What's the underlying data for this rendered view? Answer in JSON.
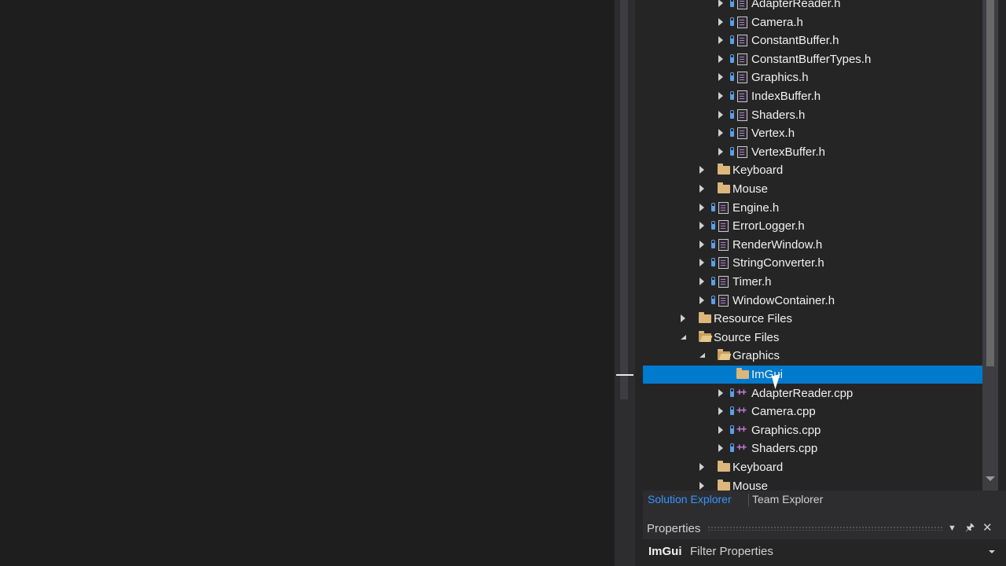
{
  "tree": [
    {
      "label": "AdapterReader.h",
      "indent": 3,
      "type": "file-h",
      "state": "collapsed",
      "lock": true
    },
    {
      "label": "Camera.h",
      "indent": 3,
      "type": "file-h",
      "state": "collapsed",
      "lock": true
    },
    {
      "label": "ConstantBuffer.h",
      "indent": 3,
      "type": "file-h",
      "state": "collapsed",
      "lock": true
    },
    {
      "label": "ConstantBufferTypes.h",
      "indent": 3,
      "type": "file-h",
      "state": "collapsed",
      "lock": true
    },
    {
      "label": "Graphics.h",
      "indent": 3,
      "type": "file-h",
      "state": "collapsed",
      "lock": true
    },
    {
      "label": "IndexBuffer.h",
      "indent": 3,
      "type": "file-h",
      "state": "collapsed",
      "lock": true
    },
    {
      "label": "Shaders.h",
      "indent": 3,
      "type": "file-h",
      "state": "collapsed",
      "lock": true
    },
    {
      "label": "Vertex.h",
      "indent": 3,
      "type": "file-h",
      "state": "collapsed",
      "lock": true
    },
    {
      "label": "VertexBuffer.h",
      "indent": 3,
      "type": "file-h",
      "state": "collapsed",
      "lock": true
    },
    {
      "label": "Keyboard",
      "indent": 2,
      "type": "folder",
      "state": "collapsed",
      "lock": false
    },
    {
      "label": "Mouse",
      "indent": 2,
      "type": "folder",
      "state": "collapsed",
      "lock": false
    },
    {
      "label": "Engine.h",
      "indent": 2,
      "type": "file-h",
      "state": "collapsed",
      "lock": true
    },
    {
      "label": "ErrorLogger.h",
      "indent": 2,
      "type": "file-h",
      "state": "collapsed",
      "lock": true
    },
    {
      "label": "RenderWindow.h",
      "indent": 2,
      "type": "file-h",
      "state": "collapsed",
      "lock": true
    },
    {
      "label": "StringConverter.h",
      "indent": 2,
      "type": "file-h",
      "state": "collapsed",
      "lock": true
    },
    {
      "label": "Timer.h",
      "indent": 2,
      "type": "file-h",
      "state": "collapsed",
      "lock": true
    },
    {
      "label": "WindowContainer.h",
      "indent": 2,
      "type": "file-h",
      "state": "collapsed",
      "lock": true
    },
    {
      "label": "Resource Files",
      "indent": 1,
      "type": "folder",
      "state": "collapsed",
      "lock": false
    },
    {
      "label": "Source Files",
      "indent": 1,
      "type": "folder-open",
      "state": "expanded",
      "lock": false
    },
    {
      "label": "Graphics",
      "indent": 2,
      "type": "folder-open",
      "state": "expanded",
      "lock": false
    },
    {
      "label": "ImGui",
      "indent": 3,
      "type": "folder",
      "state": "none",
      "lock": false,
      "selected": true
    },
    {
      "label": "AdapterReader.cpp",
      "indent": 3,
      "type": "file-cpp",
      "state": "collapsed",
      "lock": true
    },
    {
      "label": "Camera.cpp",
      "indent": 3,
      "type": "file-cpp",
      "state": "collapsed",
      "lock": true
    },
    {
      "label": "Graphics.cpp",
      "indent": 3,
      "type": "file-cpp",
      "state": "collapsed",
      "lock": true
    },
    {
      "label": "Shaders.cpp",
      "indent": 3,
      "type": "file-cpp",
      "state": "collapsed",
      "lock": true
    },
    {
      "label": "Keyboard",
      "indent": 2,
      "type": "folder",
      "state": "collapsed",
      "lock": false
    },
    {
      "label": "Mouse",
      "indent": 2,
      "type": "folder",
      "state": "collapsed",
      "lock": false
    }
  ],
  "tabs": {
    "solution_explorer": "Solution Explorer",
    "team_explorer": "Team Explorer"
  },
  "properties": {
    "title": "Properties",
    "object": "ImGui",
    "filter": "Filter Properties",
    "dropdown_glyph": "▼",
    "pin_glyph": "🖈",
    "close_glyph": "✕"
  },
  "colors": {
    "selection": "#007acc",
    "active_tab": "#3794ff"
  }
}
